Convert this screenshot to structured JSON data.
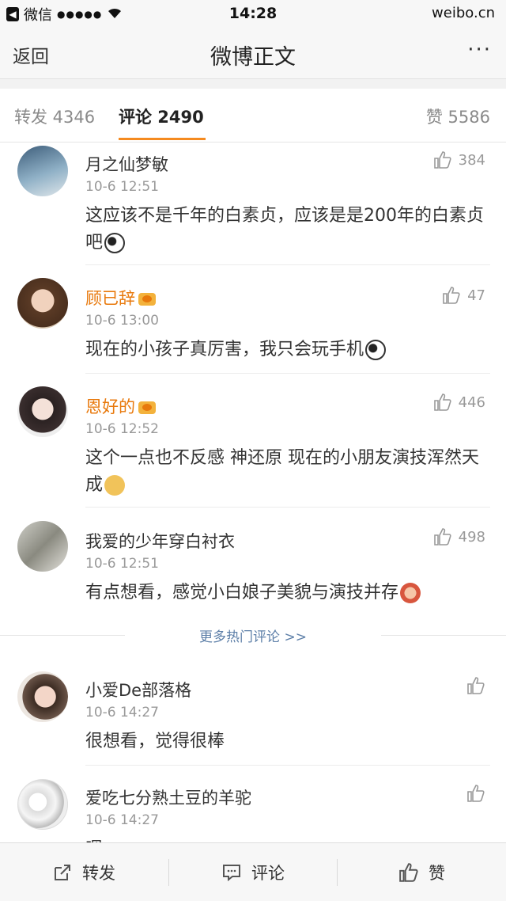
{
  "status_bar": {
    "back_app": "微信",
    "signal": "●●●●●",
    "time": "14:28",
    "domain": "weibo.cn"
  },
  "nav": {
    "back": "返回",
    "title": "微博正文",
    "more": "···"
  },
  "tabs": {
    "repost": "转发 4346",
    "comment": "评论 2490",
    "like": "赞 5586"
  },
  "hot_comments": [
    {
      "name": "月之仙梦敏",
      "vip": false,
      "time": "10-6 12:51",
      "likes": "384",
      "text": "这应该不是千年的白素贞，应该是是200年的白素贞吧",
      "emoji": "panda-emoji"
    },
    {
      "name": "顾已辞",
      "vip": true,
      "time": "10-6 13:00",
      "likes": "47",
      "text": "现在的小孩子真厉害，我只会玩手机",
      "emoji": "panda-emoji"
    },
    {
      "name": "恩好的",
      "vip": true,
      "time": "10-6 12:52",
      "likes": "446",
      "text": "这个一点也不反感 神还原 现在的小朋友演技浑然天成",
      "emoji": "doge-emoji"
    },
    {
      "name": "我爱的少年穿白衬衣",
      "vip": false,
      "time": "10-6 12:51",
      "likes": "498",
      "text": "有点想看，感觉小白娘子美貌与演技并存",
      "emoji": "shy-emoji"
    }
  ],
  "more_hot": "更多热门评论 >>",
  "latest_comments": [
    {
      "name": "小爱De部落格",
      "time": "10-6 14:27",
      "text": "很想看，觉得很棒"
    },
    {
      "name": "爱吃七分熟土豆的羊驼",
      "time": "10-6 14:27",
      "text": "嗯"
    }
  ],
  "bottom": {
    "repost": "转发",
    "comment": "评论",
    "like": "赞"
  },
  "colors": {
    "accent": "#f58a1f",
    "vip_name": "#e8790c",
    "link": "#5d7fa8"
  }
}
